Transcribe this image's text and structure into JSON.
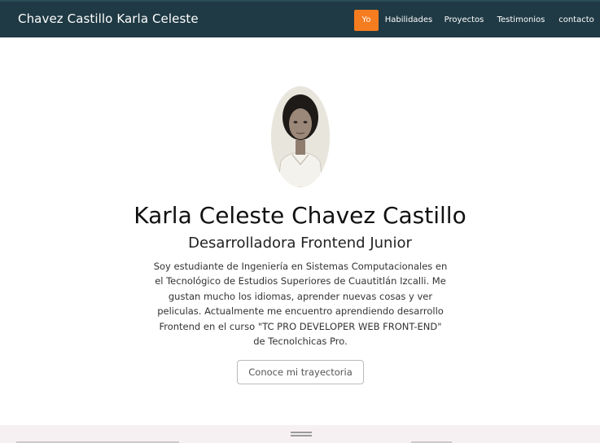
{
  "navbar": {
    "brand": "Chavez Castillo Karla Celeste",
    "items": [
      {
        "label": "Yo",
        "active": true
      },
      {
        "label": "Habilidades",
        "active": false
      },
      {
        "label": "Proyectos",
        "active": false
      },
      {
        "label": "Testimonios",
        "active": false
      },
      {
        "label": "contacto",
        "active": false
      }
    ],
    "background_color": "#1f3a44",
    "active_color": "#f57c1f"
  },
  "hero": {
    "name": "Karla Celeste Chavez Castillo",
    "role": "Desarrolladora Frontend Junior",
    "bio": "Soy estudiante de Ingeniería en Sistemas Computacionales en el Tecnológico de Estudios Superiores de Cuautitlán Izcalli. Me gustan mucho los idiomas, aprender nuevas cosas y ver peliculas. Actualmente me encuentro aprendiendo desarrollo Frontend en el curso \"TC PRO DEVELOPER WEB FRONT-END\" de Tecnolchicas Pro.",
    "cta_label": "Conoce mi trayectoria"
  }
}
